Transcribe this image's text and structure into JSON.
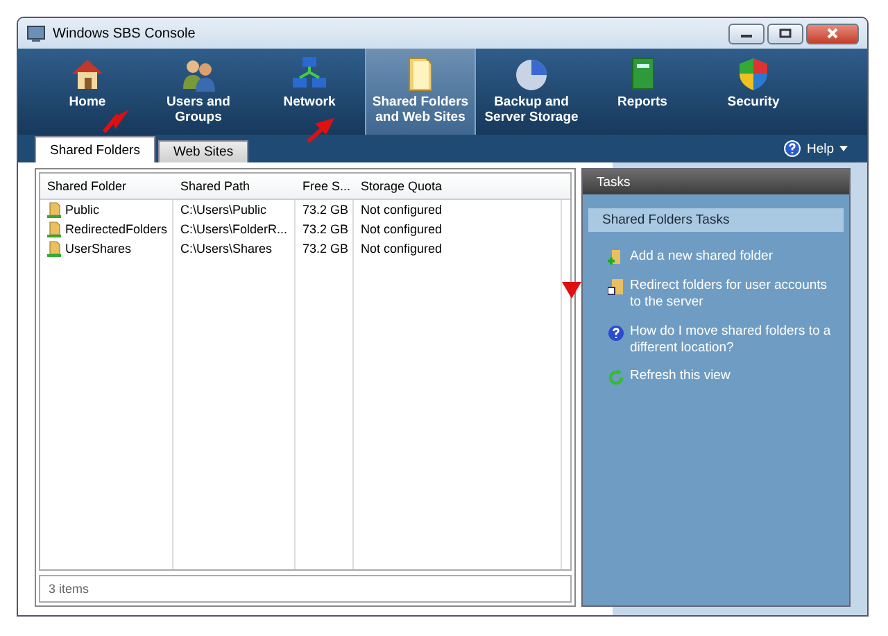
{
  "window": {
    "title": "Windows SBS Console"
  },
  "nav": [
    {
      "label": "Home",
      "kind": "home",
      "selected": false
    },
    {
      "label": "Users and Groups",
      "kind": "users",
      "selected": false
    },
    {
      "label": "Network",
      "kind": "network",
      "selected": false
    },
    {
      "label": "Shared Folders and Web Sites",
      "kind": "folder",
      "selected": true
    },
    {
      "label": "Backup and Server Storage",
      "kind": "backup",
      "selected": false
    },
    {
      "label": "Reports",
      "kind": "reports",
      "selected": false
    },
    {
      "label": "Security",
      "kind": "security",
      "selected": false
    }
  ],
  "tabs": [
    {
      "label": "Shared Folders",
      "selected": true
    },
    {
      "label": "Web Sites",
      "selected": false
    }
  ],
  "help": "Help",
  "table": {
    "columns": [
      "Shared Folder",
      "Shared Path",
      "Free S...",
      "Storage Quota"
    ],
    "rows": [
      [
        "Public",
        "C:\\Users\\Public",
        "73.2 GB",
        "Not configured"
      ],
      [
        "RedirectedFolders",
        "C:\\Users\\FolderR...",
        "73.2 GB",
        "Not configured"
      ],
      [
        "UserShares",
        "C:\\Users\\Shares",
        "73.2 GB",
        "Not configured"
      ]
    ]
  },
  "status_bar": "3 items",
  "tasks": {
    "title": "Tasks",
    "section": "Shared Folders Tasks",
    "items": [
      {
        "label": "Add a new shared folder",
        "kind": "add"
      },
      {
        "label": "Redirect folders for user accounts to the server",
        "kind": "redirect"
      },
      {
        "label": "How do I move shared folders to a different location?",
        "kind": "help"
      },
      {
        "label": "Refresh this view",
        "kind": "refresh"
      }
    ]
  }
}
